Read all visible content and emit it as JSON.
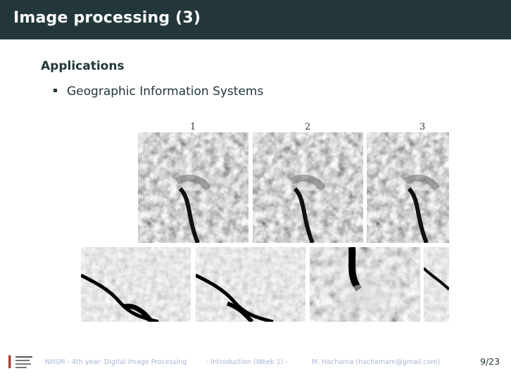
{
  "slide": {
    "title": "Image processing (3)",
    "section": "Applications",
    "bullets": [
      "Geographic Information Systems"
    ]
  },
  "figure": {
    "top_labels": [
      "1",
      "2",
      "3"
    ]
  },
  "footer": {
    "course": "NHSM - 4th year: Digital Image Processing",
    "week": "- Introduction (Week 1) -",
    "author": "M. Hachama (hachamam@gmail.com)",
    "page": "9/23"
  },
  "colors": {
    "title_bar": "#23373b",
    "text": "#23373b",
    "footer_text": "#aab4d8"
  }
}
